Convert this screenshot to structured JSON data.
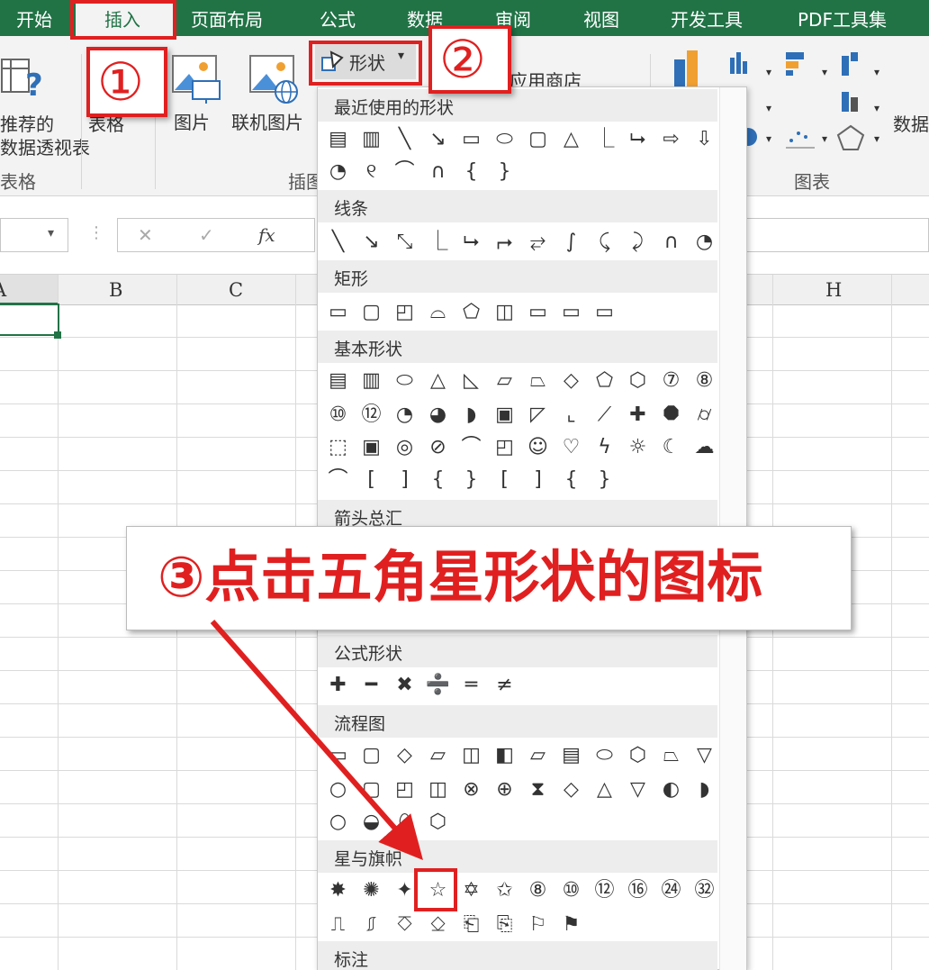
{
  "tabs": [
    {
      "label": "开始"
    },
    {
      "label": "插入"
    },
    {
      "label": "页面布局"
    },
    {
      "label": "公式"
    },
    {
      "label": "数据"
    },
    {
      "label": "审阅"
    },
    {
      "label": "视图"
    },
    {
      "label": "开发工具"
    },
    {
      "label": "PDF工具集"
    }
  ],
  "ribbon": {
    "recommended_pivot_l1": "推荐的",
    "recommended_pivot_l2": "数据透视表",
    "table": "表格",
    "picture": "图片",
    "online_picture": "联机图片",
    "shapes": "形状",
    "app_store": "应用商店",
    "data_partial": "数据",
    "group_tables": "表格",
    "group_illustrations": "插图",
    "group_charts": "图表"
  },
  "formula_bar": {
    "fx": "fx",
    "cancel": "✕",
    "confirm": "✓"
  },
  "columns": [
    "A",
    "B",
    "C",
    "H"
  ],
  "shapes_gallery": {
    "sections": [
      {
        "title": "最近使用的形状",
        "rows": [
          "▤ ▥ ╲ ↘ ▭ ⬭ ▢ △ ⎿ ⮡ ⇨ ⇩",
          "◔ ୧ ⌒ ∩ { }"
        ]
      },
      {
        "title": "线条",
        "rows": [
          "╲ ↘ ⤡ ⎿ ⮡ ⮣ ⥂ ∫ ⤹ ⤸ ∩ ◔ ୧"
        ]
      },
      {
        "title": "矩形",
        "rows": [
          "▭ ▢ ◰ ⌓ ⬠ ◫ ▭ ▭ ▭"
        ]
      },
      {
        "title": "基本形状",
        "rows": [
          "▤ ▥ ⬭ △ ◺ ▱ ⏢ ◇ ⬠ ⬡ ⑦ ⑧",
          "⑩ ⑫ ◔ ◕ ◗ ▣ ◸ ⌞ ⟋ ✚ ⯃ ⌭",
          "⬚ ▣ ◎ ⊘ ⌒ ◰ ☺ ♡ ϟ ☼ ☾ ☁",
          "⌒ [ ] { } [ ] { }"
        ]
      },
      {
        "title": "箭头总汇",
        "rows": []
      },
      {
        "title": "公式形状",
        "rows": [
          "✚ ━ ✖ ➗ ═ ≠"
        ]
      },
      {
        "title": "流程图",
        "rows": [
          "▭ ▢ ◇ ▱ ◫ ◧ ▱ ▤ ⬭ ⬡ ⏢ ▽",
          "○ ▢ ◰ ◫ ⊗ ⊕ ⧗ ◇ △ ▽ ◐ ◗",
          "○ ◒ ⬯ ⬡"
        ]
      },
      {
        "title": "星与旗帜",
        "rows": [
          "✸ ✺ ✦ ☆ ✡ ✩ ⑧ ⑩ ⑫ ⑯ ㉔ ㉜",
          "⎍ ⎎ ⎏ ⎐ ⎗ ⎘ ⚐ ⚑"
        ]
      },
      {
        "title": "标注",
        "rows": []
      }
    ]
  },
  "annotations": {
    "step1": "①",
    "step2": "②",
    "step3": "③点击五角星形状的图标"
  },
  "colors": {
    "excel_green": "#217346",
    "annotation_red": "#e02020"
  }
}
